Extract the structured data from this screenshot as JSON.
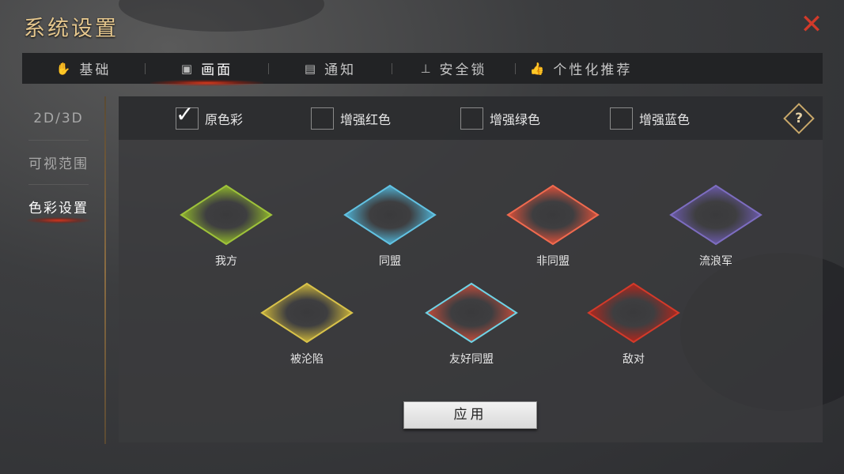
{
  "window": {
    "title": "系统设置"
  },
  "tabs": [
    {
      "label": "基础",
      "icon": "hand-icon"
    },
    {
      "label": "画面",
      "icon": "image-icon",
      "active": true
    },
    {
      "label": "通知",
      "icon": "chat-bubble-icon"
    },
    {
      "label": "安全锁",
      "icon": "lock-icon"
    },
    {
      "label": "个性化推荐",
      "icon": "thumbs-up-icon"
    }
  ],
  "subnav": [
    {
      "label": "2D/3D"
    },
    {
      "label": "可视范围"
    },
    {
      "label": "色彩设置",
      "active": true
    }
  ],
  "color_modes": [
    {
      "label": "原色彩",
      "checked": true
    },
    {
      "label": "增强红色",
      "checked": false
    },
    {
      "label": "增强绿色",
      "checked": false
    },
    {
      "label": "增强蓝色",
      "checked": false
    }
  ],
  "help": {
    "glyph": "?"
  },
  "swatches": [
    {
      "label": "我方",
      "color": "#8fb52c",
      "border": "#9ec23a"
    },
    {
      "label": "同盟",
      "color": "#4fb0d2",
      "border": "#62c2e2"
    },
    {
      "label": "非同盟",
      "color": "#d9503a",
      "border": "#ef6a4f"
    },
    {
      "label": "流浪军",
      "color": "#6a5aa8",
      "border": "#7d6dc0"
    },
    {
      "label": "被沦陷",
      "color": "#c9b23a",
      "border": "#d8c24a"
    },
    {
      "label": "友好同盟",
      "color": "#c44b3a",
      "border": "#6fd3e6"
    },
    {
      "label": "敌对",
      "color": "#b3261c",
      "border": "#d33a2a"
    }
  ],
  "apply_button": {
    "label": "应用"
  },
  "close_button": {
    "glyph": "✕"
  }
}
